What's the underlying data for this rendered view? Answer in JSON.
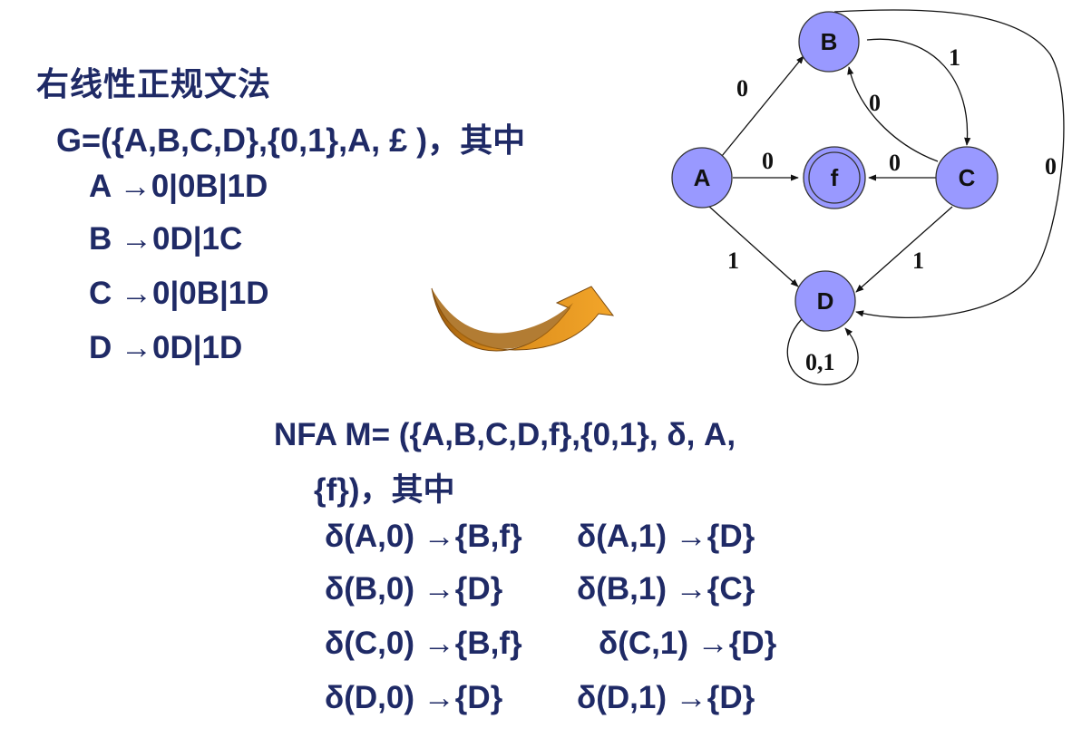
{
  "grammar": {
    "title": "右线性正规文法",
    "definition": "G=({A,B,C,D},{0,1},A, £ )，其中",
    "rules": [
      "A →0|0B|1D",
      "B →0D|1C",
      "C →0|0B|1D",
      "D →0D|1D"
    ]
  },
  "nfa": {
    "definition_line1": "NFA M= ({A,B,C,D,f},{0,1}, δ, A,",
    "definition_line2": "{f})，其中",
    "transitions": [
      {
        "left": "δ(A,0) →{B,f}",
        "right": "δ(A,1) →{D}"
      },
      {
        "left": "δ(B,0) →{D}",
        "right": "δ(B,1) →{C}"
      },
      {
        "left": "δ(C,0) →{B,f}",
        "right": "δ(C,1) →{D}"
      },
      {
        "left": "δ(D,0) →{D}",
        "right": "δ(D,1) →{D}"
      }
    ]
  },
  "diagram": {
    "state_fill": "#9999ff",
    "states": {
      "A": "A",
      "B": "B",
      "C": "C",
      "D": "D",
      "f": "f"
    },
    "edges": {
      "A_B": "0",
      "A_f": "0",
      "A_D": "1",
      "B_C": "1",
      "C_B": "0",
      "C_f": "0",
      "C_D": "1",
      "B_D": "0",
      "D_D": "0,1"
    }
  },
  "arrow_icon": {
    "fill": "#e89a1e",
    "dark_fill": "#b86d10"
  }
}
